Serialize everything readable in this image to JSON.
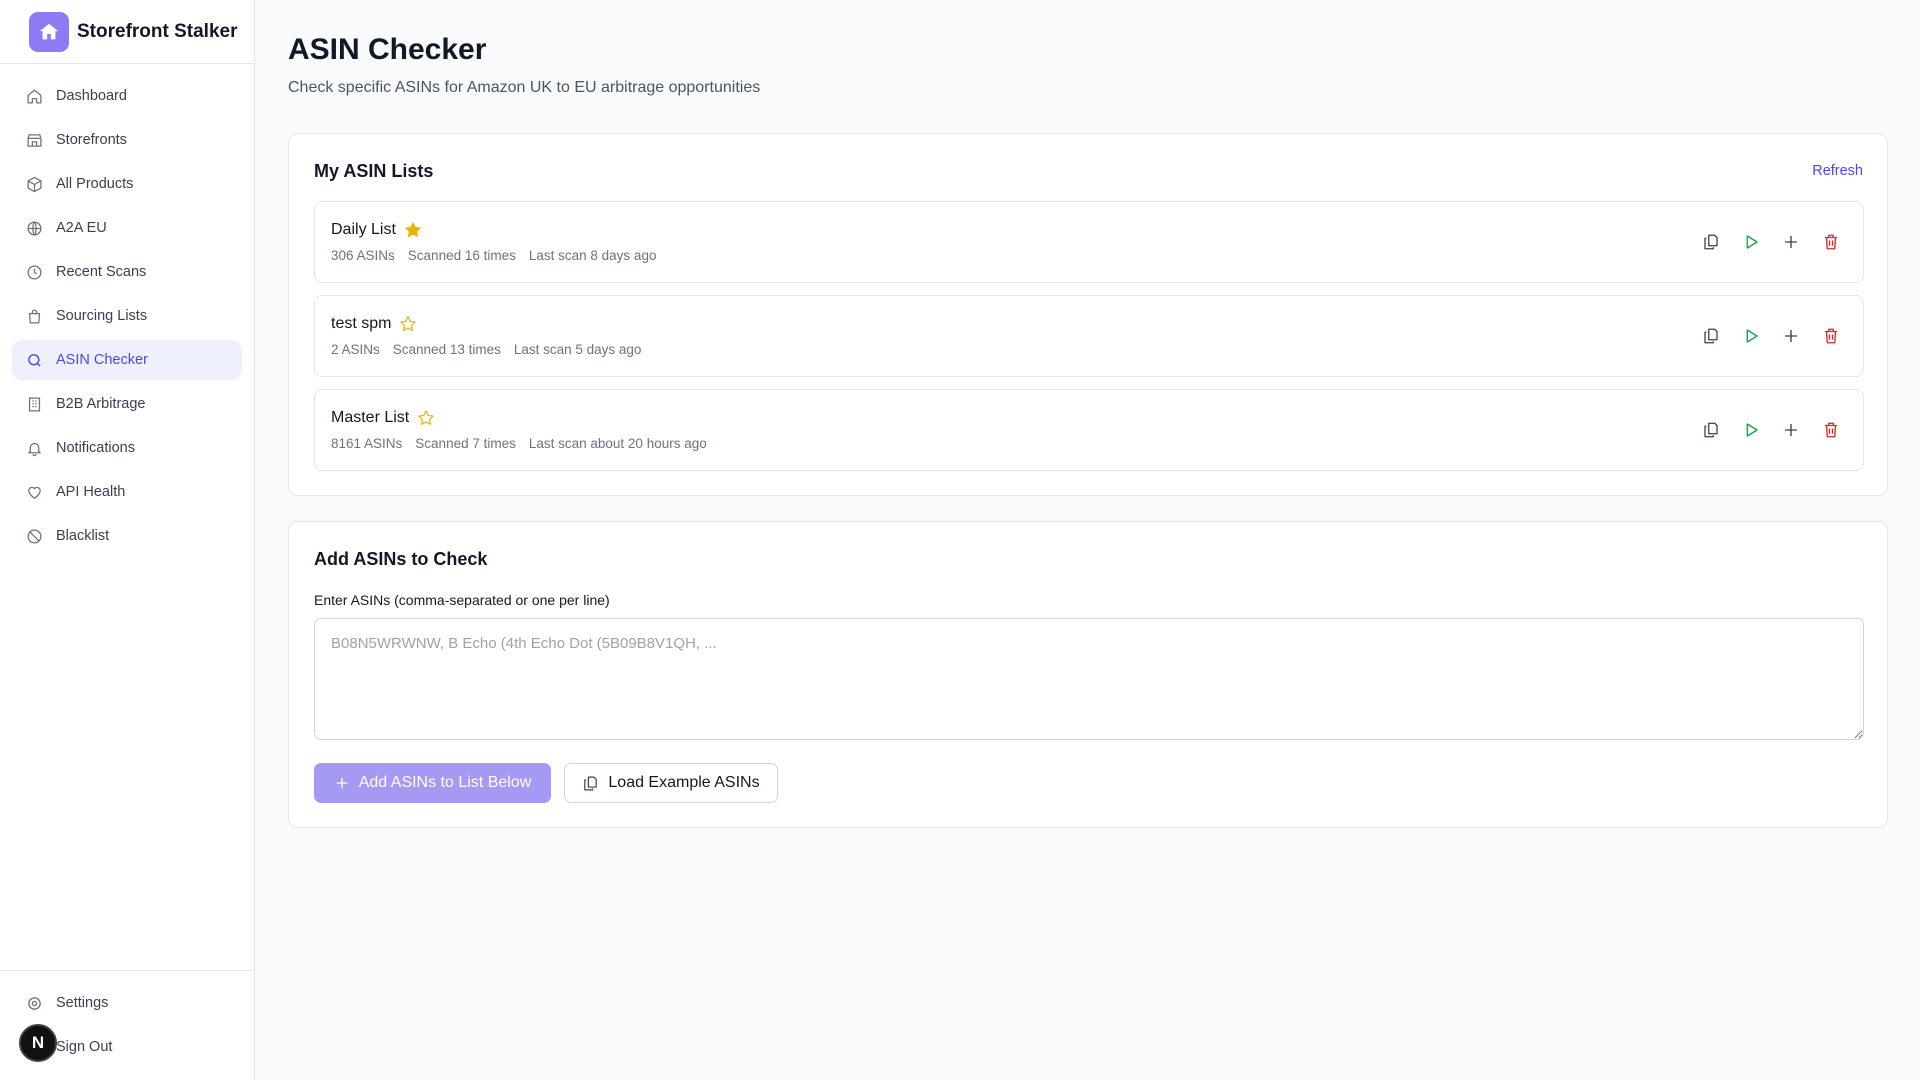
{
  "app": {
    "name": "Storefront Stalker"
  },
  "sidebar": {
    "items": [
      {
        "label": "Dashboard",
        "icon": "home-icon"
      },
      {
        "label": "Storefronts",
        "icon": "store-icon"
      },
      {
        "label": "All Products",
        "icon": "package-icon"
      },
      {
        "label": "A2A EU",
        "icon": "globe-icon"
      },
      {
        "label": "Recent Scans",
        "icon": "clock-icon"
      },
      {
        "label": "Sourcing Lists",
        "icon": "shopping-bag-icon"
      },
      {
        "label": "ASIN Checker",
        "icon": "search-icon",
        "active": true
      },
      {
        "label": "B2B Arbitrage",
        "icon": "building-icon"
      },
      {
        "label": "Notifications",
        "icon": "bell-icon"
      },
      {
        "label": "API Health",
        "icon": "heart-icon"
      },
      {
        "label": "Blacklist",
        "icon": "ban-icon"
      }
    ],
    "bottom": [
      {
        "label": "Settings",
        "icon": "gear-icon"
      },
      {
        "label": "Sign Out",
        "icon": "sign-out-icon"
      }
    ],
    "badge": "N"
  },
  "page": {
    "title": "ASIN Checker",
    "subtitle": "Check specific ASINs for Amazon UK to EU arbitrage opportunities"
  },
  "lists_card": {
    "title": "My ASIN Lists",
    "refresh_label": "Refresh",
    "lists": [
      {
        "name": "Daily List",
        "starred": true,
        "asins": "306 ASINs",
        "scanned": "Scanned 16 times",
        "last_scan": "Last scan 8 days ago"
      },
      {
        "name": "test spm",
        "starred": false,
        "asins": "2 ASINs",
        "scanned": "Scanned 13 times",
        "last_scan": "Last scan 5 days ago"
      },
      {
        "name": "Master List",
        "starred": false,
        "asins": "8161 ASINs",
        "scanned": "Scanned 7 times",
        "last_scan": "Last scan about 20 hours ago"
      }
    ]
  },
  "add_card": {
    "title": "Add ASINs to Check",
    "field_label": "Enter ASINs (comma-separated or one per line)",
    "placeholder": "B08N5WRWNW, B Echo (4th Echo Dot (5B09B8V1QH, ...",
    "value": "",
    "add_button": "Add ASINs to List Below",
    "example_button": "Load Example ASINs"
  },
  "colors": {
    "accent": "#4f46e5",
    "brand": "#8b7cf6",
    "star": "#eab308",
    "play": "#16a34a",
    "delete": "#dc2626"
  }
}
